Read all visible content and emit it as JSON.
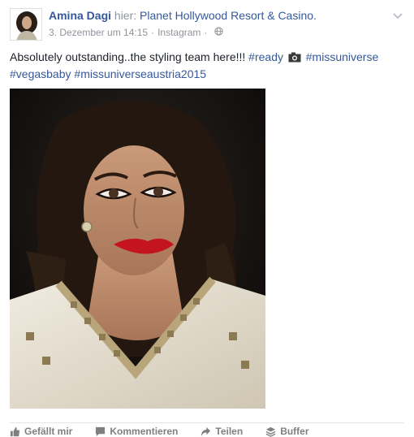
{
  "post": {
    "author": "Amina Dagi",
    "location_prefix": "hier:",
    "location": "Planet Hollywood Resort & Casino.",
    "timestamp": "3. Dezember um 14:15",
    "separator": "·",
    "source": "Instagram",
    "text_main": "Absolutely outstanding..the styling team here!!! ",
    "hashtags": [
      "#ready",
      "#missuniverse",
      "#vegasbaby",
      "#missuniverseaustria2015"
    ]
  },
  "actions": {
    "like": "Gefällt mir",
    "comment": "Kommentieren",
    "share": "Teilen",
    "buffer": "Buffer"
  },
  "colors": {
    "link": "#365899",
    "meta": "#90949c",
    "text": "#1d2129",
    "lips": "#c4141f",
    "dress": "#ece6d6"
  },
  "icons": {
    "avatar": "profile-photo",
    "menu": "chevron-down-icon",
    "privacy": "globe-icon",
    "emoji": "camera-icon",
    "like": "thumbs-up-icon",
    "comment": "comment-icon",
    "share": "share-arrow-icon",
    "buffer": "buffer-icon"
  }
}
